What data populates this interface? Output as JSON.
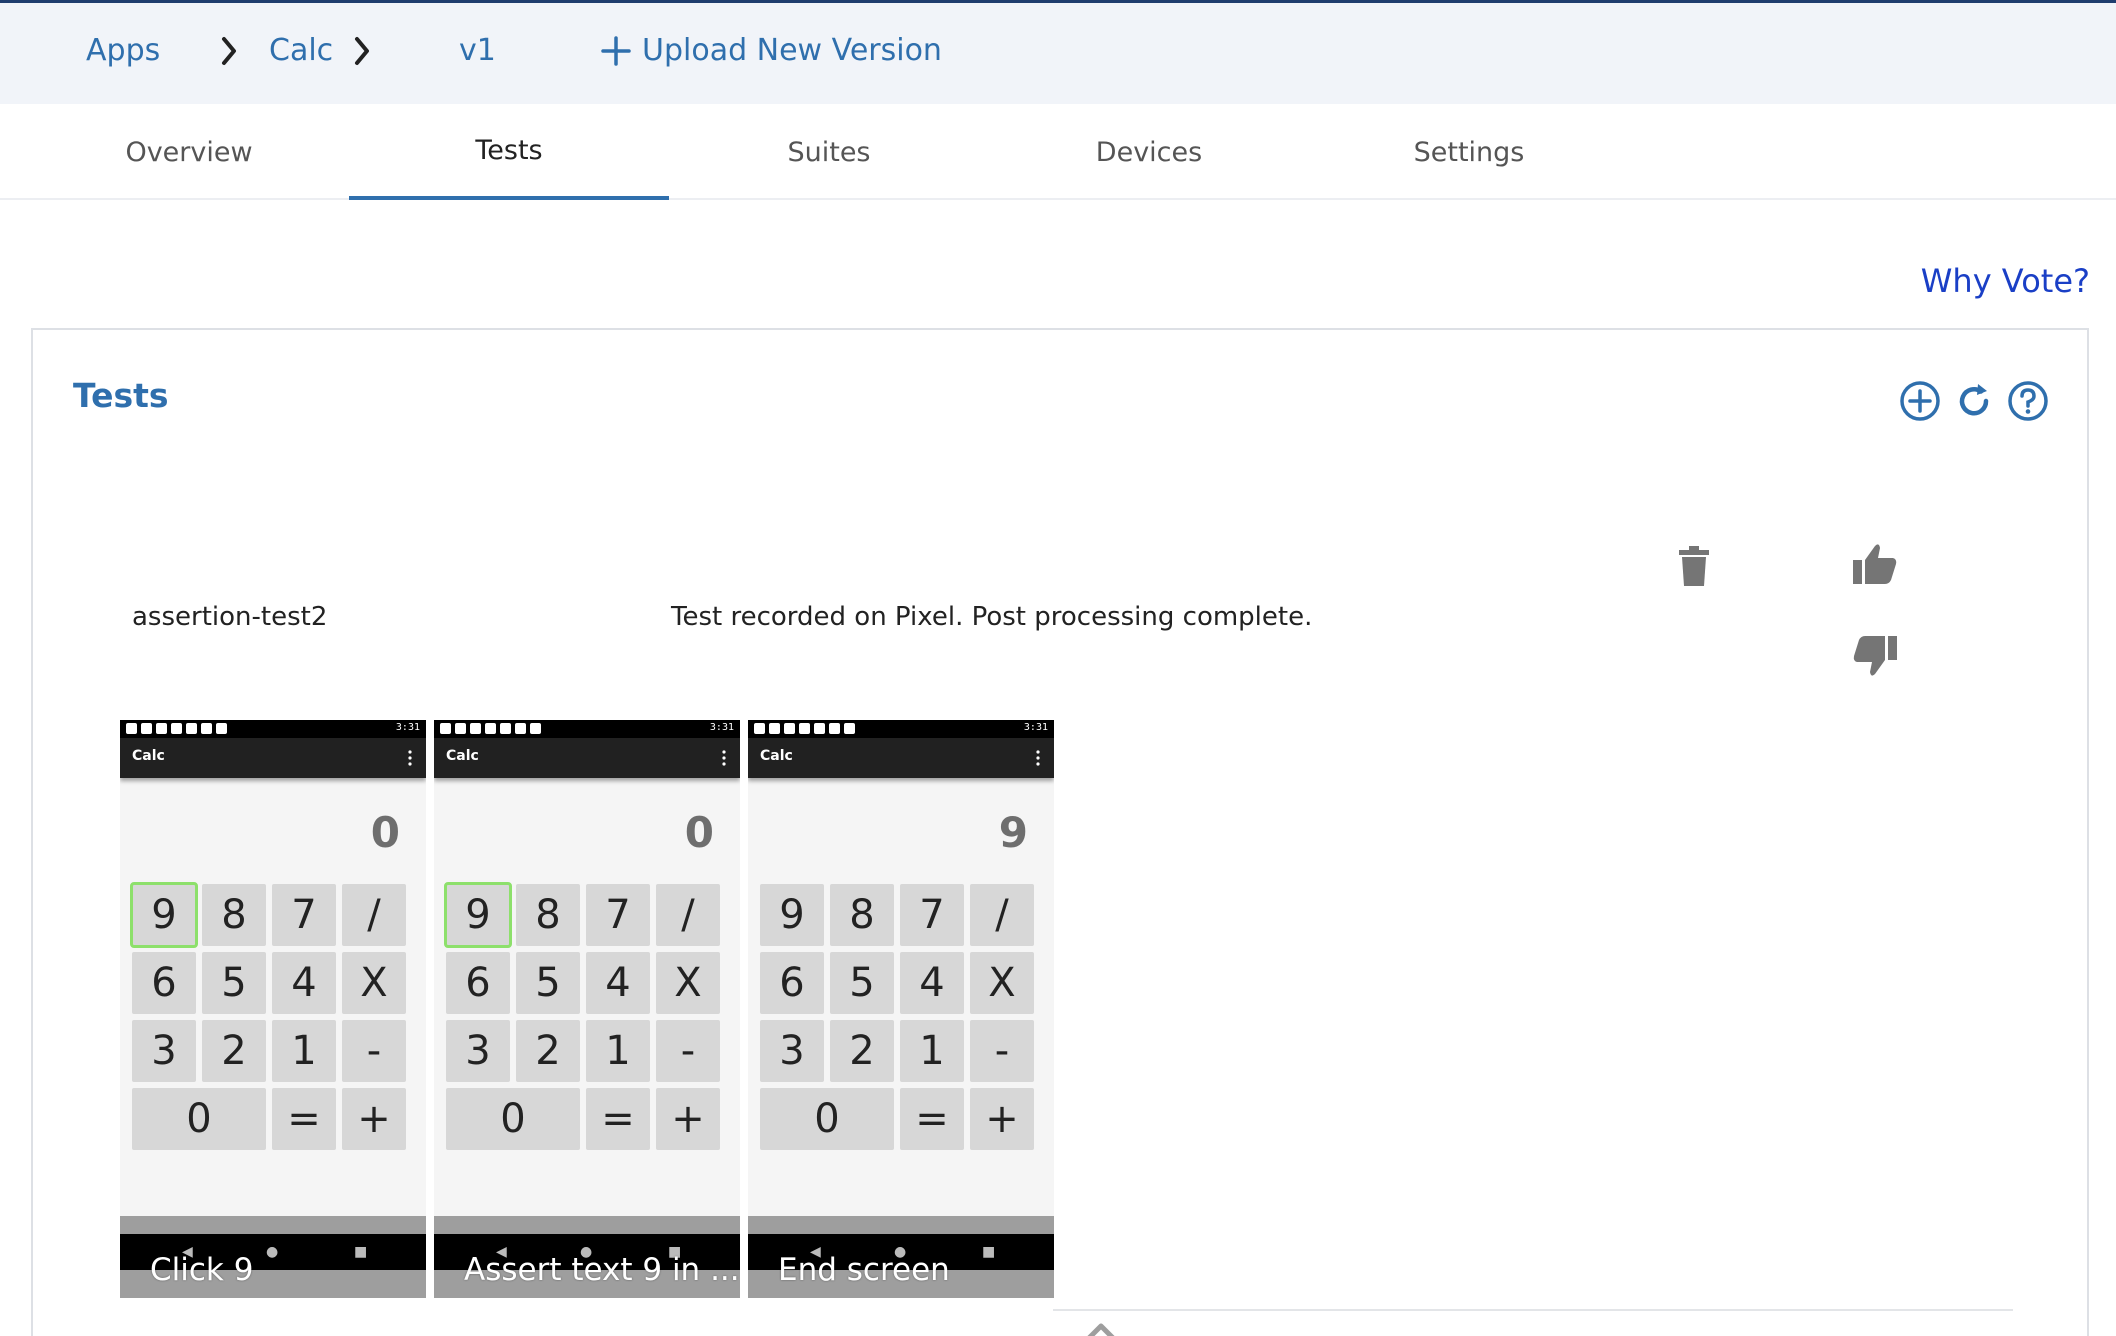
{
  "breadcrumb": {
    "apps": "Apps",
    "app": "Calc",
    "version": "v1",
    "upload_label": "Upload New Version"
  },
  "tabs": [
    "Overview",
    "Tests",
    "Suites",
    "Devices",
    "Settings"
  ],
  "active_tab": "Tests",
  "why_vote": "Why Vote?",
  "card": {
    "title": "Tests",
    "actions": [
      "add-circle-icon",
      "refresh-icon",
      "help-circle-icon"
    ]
  },
  "test": {
    "name": "assertion-test2",
    "status": "Test recorded on Pixel. Post processing complete.",
    "icons": [
      "trash-icon",
      "thumbs-up-icon",
      "thumbs-down-icon"
    ]
  },
  "screenshots": [
    {
      "app_title": "Calc",
      "time": "3:31",
      "display": "0",
      "highlight": "9",
      "caption": "Click 9"
    },
    {
      "app_title": "Calc",
      "time": "3:31",
      "display": "0",
      "highlight": "9",
      "caption": "Assert text 9 in ..."
    },
    {
      "app_title": "Calc",
      "time": "3:31",
      "display": "9",
      "highlight": "",
      "caption": "End screen"
    }
  ],
  "keypad": [
    "9",
    "8",
    "7",
    "/",
    "6",
    "5",
    "4",
    "X",
    "3",
    "2",
    "1",
    "-",
    "0",
    "=",
    "+"
  ],
  "colors": {
    "accent": "#2f6fad",
    "link": "#1a3fc6",
    "header_bg": "#f1f4f9",
    "icon_gray": "#757575",
    "highlight": "#8de06b"
  }
}
